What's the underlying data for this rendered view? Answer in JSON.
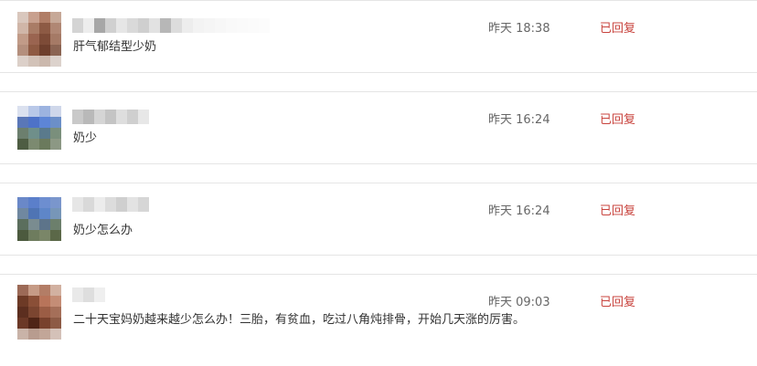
{
  "messages": [
    {
      "text": "肝气郁结型少奶",
      "time": "昨天 18:38",
      "status": "已回复",
      "avatar": {
        "icon": "user-avatar-pixelated",
        "colors": [
          "#d9c7bd",
          "#c8a08e",
          "#b07d66",
          "#c6a897",
          "#d0b6a8",
          "#a97c66",
          "#8d5a44",
          "#b08774",
          "#c19b88",
          "#9a6450",
          "#7d4b37",
          "#a57a66",
          "#b48f7d",
          "#8e5a43",
          "#6e3f2d",
          "#8b6453",
          "#dcd0c9",
          "#d2c2b8",
          "#cbb8ad",
          "#dcd2cc"
        ]
      },
      "name_blur_colors": [
        "#d4d4d4",
        "#ededed",
        "#a7a7a7",
        "#d0d0d0",
        "#e6e6e6",
        "#d9d9d9",
        "#cfcfcf",
        "#e2e2e2",
        "#b7b7b7",
        "#dcdcdc",
        "#ededed",
        "#f3f3f3",
        "#f5f5f5",
        "#f7f7f7",
        "#f9f9f9",
        "#fafafa",
        "#fbfbfb",
        "#fcfcfc"
      ]
    },
    {
      "text": "奶少",
      "time": "昨天 16:24",
      "status": "已回复",
      "avatar": {
        "icon": "user-avatar-pixelated",
        "colors": [
          "#dbe1ef",
          "#b9c8e8",
          "#9cb3e0",
          "#cfd7ea",
          "#5a77b8",
          "#4e72c8",
          "#5d85d6",
          "#6c8fc8",
          "#6c7f6e",
          "#6f8f8a",
          "#5a7a8c",
          "#7a8f7c",
          "#4e5d43",
          "#7c8a70",
          "#6b7a5d",
          "#8c9884"
        ]
      },
      "name_blur_colors": [
        "#c9c9c9",
        "#b9b9b9",
        "#d5d5d5",
        "#c4c4c4",
        "#dedede",
        "#cfcfcf",
        "#e7e7e7"
      ]
    },
    {
      "text": "奶少怎么办",
      "time": "昨天 16:24",
      "status": "已回复",
      "avatar": {
        "icon": "user-avatar-pixelated",
        "colors": [
          "#6a88c8",
          "#5b7fca",
          "#6d8ed0",
          "#7a96cc",
          "#7088a0",
          "#4f74b4",
          "#5e86c8",
          "#7796b8",
          "#5b6e5d",
          "#7a8c90",
          "#5d748a",
          "#6c7f6c",
          "#4c5a3e",
          "#6e7c5e",
          "#7a8668",
          "#5b6848"
        ]
      },
      "name_blur_colors": [
        "#e6e6e6",
        "#d9d9d9",
        "#ececec",
        "#dcdcdc",
        "#cfcfcf",
        "#e3e3e3",
        "#d6d6d6"
      ]
    },
    {
      "text": "二十天宝妈奶越来越少怎么办！三胎，有贫血，吃过八角炖排骨，开始几天涨的厉害。",
      "time": "昨天 09:03",
      "status": "已回复",
      "avatar": {
        "icon": "user-avatar-pixelated",
        "colors": [
          "#9c6a57",
          "#c69b86",
          "#b37d66",
          "#d2b1a1",
          "#6d3a26",
          "#8a4f37",
          "#b8745a",
          "#c48d76",
          "#5c2e1f",
          "#7b4530",
          "#9b5d45",
          "#a56f59",
          "#6b3826",
          "#4f2416",
          "#78412d",
          "#8d5a45",
          "#c9b3a8",
          "#b89c8f",
          "#c2a698",
          "#d4c1b8"
        ]
      },
      "name_blur_colors": [
        "#e9e9e9",
        "#dedede",
        "#efefef"
      ]
    }
  ]
}
